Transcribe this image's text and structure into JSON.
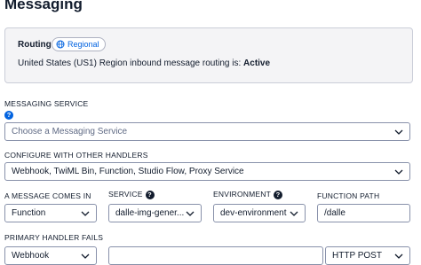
{
  "page": {
    "title": "Messaging"
  },
  "routing": {
    "title": "Routing",
    "badge_label": "Regional",
    "message_prefix": "United States (US1) Region inbound message routing is: ",
    "status": "Active"
  },
  "messaging_service": {
    "label": "MESSAGING SERVICE",
    "help_icon": "?",
    "placeholder": "Choose a Messaging Service"
  },
  "other_handlers": {
    "label": "CONFIGURE WITH OTHER HANDLERS",
    "value": "Webhook, TwiML Bin, Function, Studio Flow, Proxy Service"
  },
  "message_comes_in": {
    "label": "A MESSAGE COMES IN",
    "value": "Function"
  },
  "service": {
    "label": "SERVICE",
    "help_icon": "?",
    "value": "dalle-img-gener..."
  },
  "environment": {
    "label": "ENVIRONMENT",
    "help_icon": "?",
    "value": "dev-environment"
  },
  "function_path": {
    "label": "FUNCTION PATH",
    "value": "/dalle"
  },
  "primary_handler_fails": {
    "label": "PRIMARY HANDLER FAILS",
    "value": "Webhook",
    "url_value": "",
    "method": "HTTP POST"
  },
  "icons": {
    "chevron": "chevron-down-icon",
    "globe": "globe-icon",
    "help": "help-icon"
  },
  "colors": {
    "accent": "#0263e0",
    "border": "#8891aa",
    "box_bg": "#f4f4f6"
  }
}
